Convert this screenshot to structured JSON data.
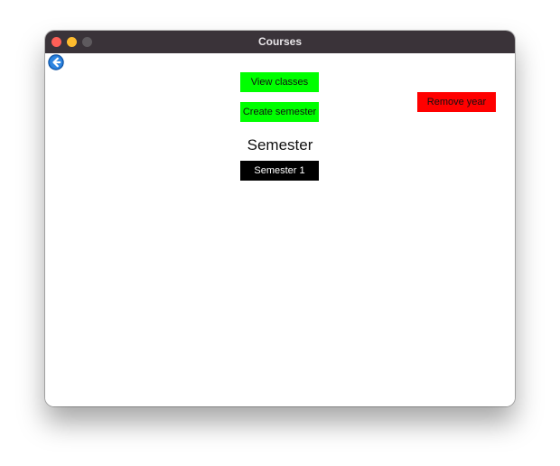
{
  "window": {
    "title": "Courses"
  },
  "toolbar": {
    "back_icon": "back-arrow-icon"
  },
  "main": {
    "view_classes_label": "View classes",
    "create_semester_label": "Create semester",
    "remove_year_label": "Remove year",
    "section_heading": "Semester",
    "semesters": [
      {
        "label": "Semester 1"
      }
    ]
  },
  "colors": {
    "titlebar": "#3a3339",
    "green_button": "#00ff00",
    "red_button": "#ff0000",
    "semester_button": "#000000",
    "back_icon": "#1e73d2"
  }
}
